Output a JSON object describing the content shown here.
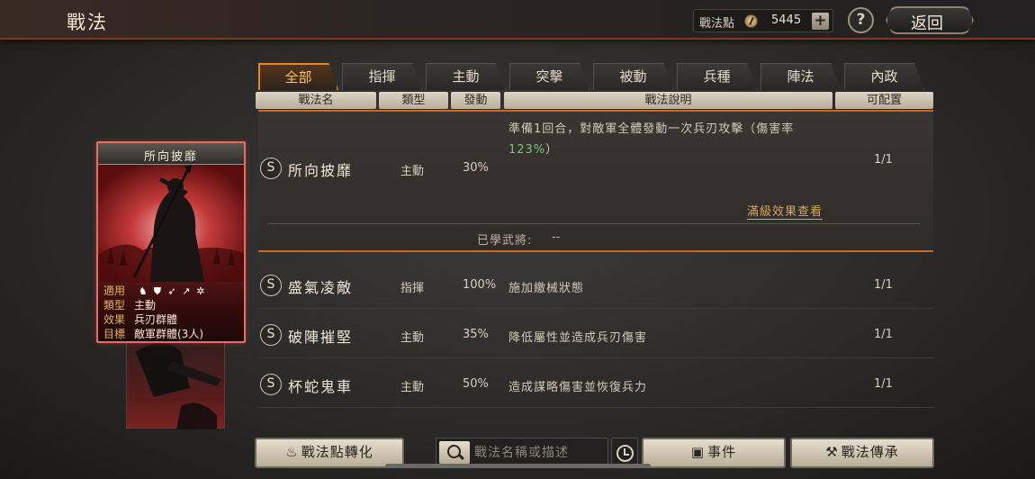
{
  "header": {
    "title": "戰法",
    "points_label": "戰法點",
    "points_value": "5445",
    "add_label": "+",
    "help_label": "?",
    "back_label": "返回"
  },
  "tabs": [
    "全部",
    "指揮",
    "主動",
    "突擊",
    "被動",
    "兵種",
    "陣法",
    "內政"
  ],
  "active_tab": "全部",
  "columns": [
    "戰法名",
    "類型",
    "發動",
    "戰法說明",
    "可配置"
  ],
  "expanded_skill": {
    "grade": "S",
    "name": "所向披靡",
    "type": "主動",
    "rate": "30%",
    "desc_part1": "準備1回合，對敵軍全體發動一次兵刃攻擊（傷害率",
    "desc_highlight": "123%",
    "desc_part2": "）",
    "slots": "1/1",
    "full_effect_link": "滿級效果查看",
    "learned_label": "已學武將:",
    "learned_value": "--"
  },
  "skills": [
    {
      "grade": "S",
      "name": "盛氣凌敵",
      "type": "指揮",
      "rate": "100%",
      "desc": "施加繳械狀態",
      "slots": "1/1"
    },
    {
      "grade": "S",
      "name": "破陣摧堅",
      "type": "主動",
      "rate": "35%",
      "desc": "降低屬性並造成兵刃傷害",
      "slots": "1/1"
    },
    {
      "grade": "S",
      "name": "杯蛇鬼車",
      "type": "主動",
      "rate": "50%",
      "desc": "造成謀略傷害並恢復兵力",
      "slots": "1/1"
    }
  ],
  "card": {
    "title": "所向披靡",
    "applies_label": "適用",
    "type_label": "類型",
    "type_value": "主動",
    "effect_label": "效果",
    "effect_value": "兵刃群體",
    "target_label": "目標",
    "target_value": "敵軍群體(3人)",
    "unit_icons": [
      "cavalry-icon",
      "shield-icon",
      "bow-icon",
      "spear-icon",
      "wheel-icon"
    ]
  },
  "bottom": {
    "convert_label": "戰法點轉化",
    "search_placeholder": "戰法名稱或描述",
    "events_label": "事件",
    "inherit_label": "戰法傳承"
  }
}
